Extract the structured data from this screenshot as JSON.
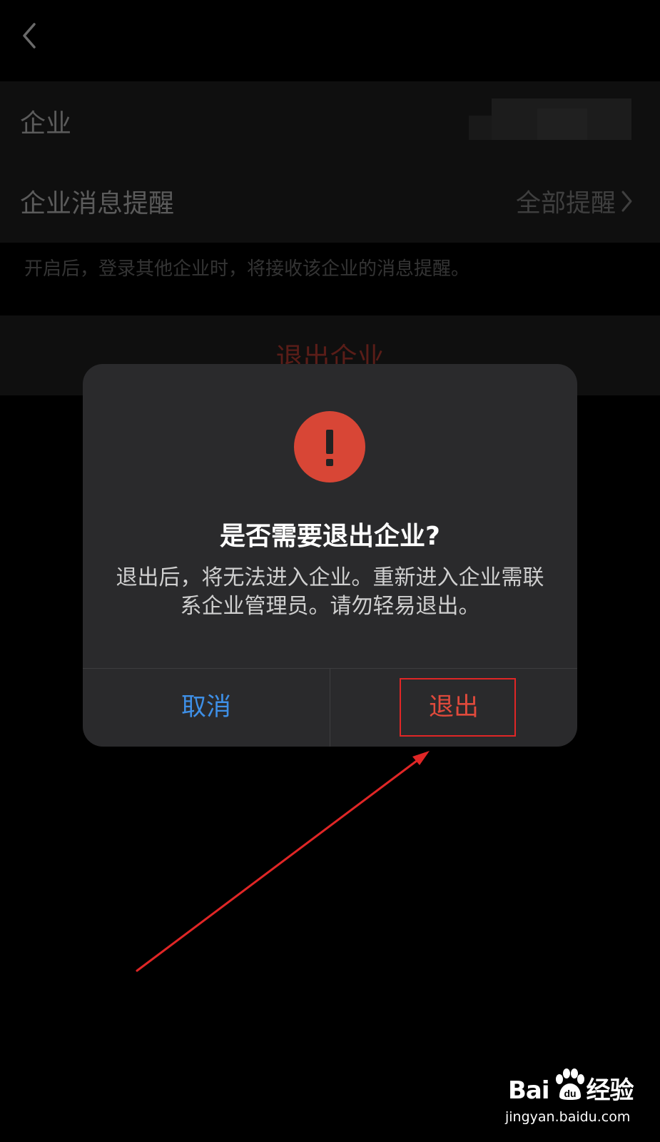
{
  "nav": {
    "back_icon": "chevron-left-icon"
  },
  "settings": {
    "company_row": {
      "label": "企业"
    },
    "notify_row": {
      "label": "企业消息提醒",
      "value": "全部提醒",
      "chevron_icon": "chevron-right-icon"
    },
    "hint": "开启后，登录其他企业时，将接收该企业的消息提醒。",
    "exit_label": "退出企业"
  },
  "dialog": {
    "icon": "alert-exclamation-icon",
    "title": "是否需要退出企业?",
    "message": "退出后，将无法进入企业。重新进入企业需联系企业管理员。请勿轻易退出。",
    "cancel_label": "取消",
    "confirm_label": "退出"
  },
  "watermark": {
    "logo_left": "Bai",
    "logo_right": "经验",
    "url": "jingyan.baidu.com"
  },
  "colors": {
    "background": "#000000",
    "dialog_bg": "#2a2a2c",
    "alert_red": "#d84636",
    "cancel_blue": "#3e8fe6",
    "confirm_red": "#e04a3c",
    "annotation_red": "#e02626"
  }
}
